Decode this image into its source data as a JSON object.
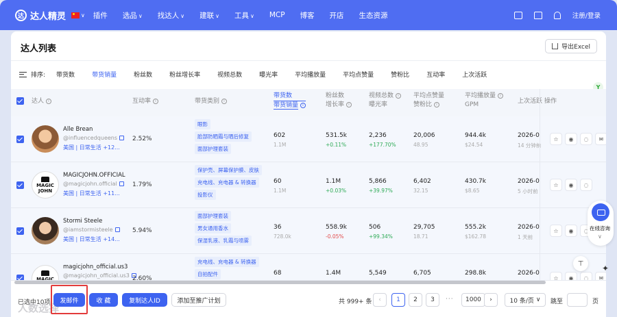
{
  "nav": {
    "logo_mark": "达",
    "brand": "达人精灵",
    "items": [
      "插件",
      "选品",
      "找达人",
      "建联",
      "工具",
      "MCP",
      "博客",
      "开店",
      "生态资源"
    ],
    "dropdown_marks": [
      "∨",
      "∨",
      "∨",
      "∨"
    ],
    "login": "注册/登录"
  },
  "page": {
    "title": "达人列表",
    "export_label": "导出Excel"
  },
  "sort": {
    "label": "排序:",
    "options": [
      "带货数",
      "带货销量",
      "粉丝数",
      "粉丝增长率",
      "视频总数",
      "曝光率",
      "平均播放量",
      "平均点赞量",
      "赞粉比",
      "互动率",
      "上次活跃"
    ],
    "active": "带货销量"
  },
  "table": {
    "headers": {
      "influencer": "达人",
      "engagement": "互动率",
      "category": "带货类别",
      "items_count": "带货数",
      "items_sales": "带货销量",
      "followers": "粉丝数",
      "follower_growth": "增长率",
      "videos": "视频总数",
      "exposure": "曝光率",
      "avg_likes": "平均点赞量",
      "like_ratio": "赞粉比",
      "avg_plays": "平均播放量",
      "gpm": "GPM",
      "last_active": "上次活跃",
      "actions": "操作"
    },
    "rows": [
      {
        "name": "Alle Brean",
        "handle": "@influencedqueens",
        "region": "美国 | 日常生活 +12...",
        "engagement": "2.52%",
        "tags": [
          "眼影",
          "脸部防晒霜与晒后修复",
          "面部护理套装"
        ],
        "items": "602",
        "sales": "1.1M",
        "followers": "531.5k",
        "growth": "+0.11%",
        "videos": "2,236",
        "exposure": "+177.70%",
        "avg_likes": "20,006",
        "like_ratio": "48.95",
        "avg_plays": "944.4k",
        "gpm": "$24.54",
        "last_active": "2026-0",
        "last_active_sub": "14 分钟前",
        "action_icons": [
          "☆",
          "◉",
          "◌",
          "✉"
        ]
      },
      {
        "name": "MAGICJOHN.OFFICIAL",
        "handle": "@magicjohn.official",
        "region": "美国 | 日常生活 +11...",
        "engagement": "1.79%",
        "tags": [
          "保护壳、屏幕保护膜、皮肤",
          "充电线、充电器 & 转换器",
          "投影仪"
        ],
        "items": "60",
        "sales": "1.1M",
        "followers": "1.1M",
        "growth": "+0.03%",
        "videos": "5,866",
        "exposure": "+39.97%",
        "avg_likes": "6,402",
        "like_ratio": "32.15",
        "avg_plays": "430.7k",
        "gpm": "$8.65",
        "last_active": "2026-0",
        "last_active_sub": "5 小时前",
        "action_icons": [
          "☆",
          "◉",
          "◌"
        ]
      },
      {
        "name": "Stormi Steele",
        "handle": "@iamstormisteele",
        "region": "美国 | 日常生活 +14...",
        "engagement": "5.94%",
        "tags": [
          "面部护理套装",
          "男女通用香水",
          "保湿乳液、乳霜与喷雾"
        ],
        "items": "36",
        "sales": "728.0k",
        "followers": "558.9k",
        "growth": "-0.05%",
        "videos": "506",
        "exposure": "+99.34%",
        "avg_likes": "29,705",
        "like_ratio": "18.71",
        "avg_plays": "555.2k",
        "gpm": "$162.78",
        "last_active": "2026-0",
        "last_active_sub": "1 天前",
        "action_icons": [
          "☆",
          "◉",
          "◌",
          "✉"
        ]
      },
      {
        "name": "magicjohn_official.us3",
        "handle": "@magicjohn_official.us3",
        "region": "",
        "engagement": "2.60%",
        "tags": [
          "充电线、充电器 & 转换器",
          "自拍配件"
        ],
        "items": "68",
        "sales": "",
        "followers": "1.4M",
        "growth": "",
        "videos": "5,549",
        "exposure": "",
        "avg_likes": "6,705",
        "like_ratio": "",
        "avg_plays": "298.8k",
        "gpm": "",
        "last_active": "2026-0",
        "last_active_sub": "",
        "action_icons": [
          "☆",
          "◉",
          "◌",
          "✉"
        ]
      }
    ]
  },
  "footer": {
    "selected": "已选中10项",
    "contact": "发邮件",
    "collect": "收 藏",
    "copy_id": "复制达人ID",
    "add_plan": "添加至推广计划",
    "watermark": "人数选择",
    "total": "共 999+ 条",
    "pages": [
      "1",
      "2",
      "3",
      "1000"
    ],
    "current_page": "1",
    "per_page": "10 条/页",
    "jump_label": "跳至",
    "page_suffix": "页"
  },
  "floating": {
    "chat_label": "在线咨询"
  },
  "colors": {
    "brand": "#4f6df2",
    "accent": "#3d63f0",
    "positive": "#2daa55",
    "negative": "#e24b4b"
  }
}
